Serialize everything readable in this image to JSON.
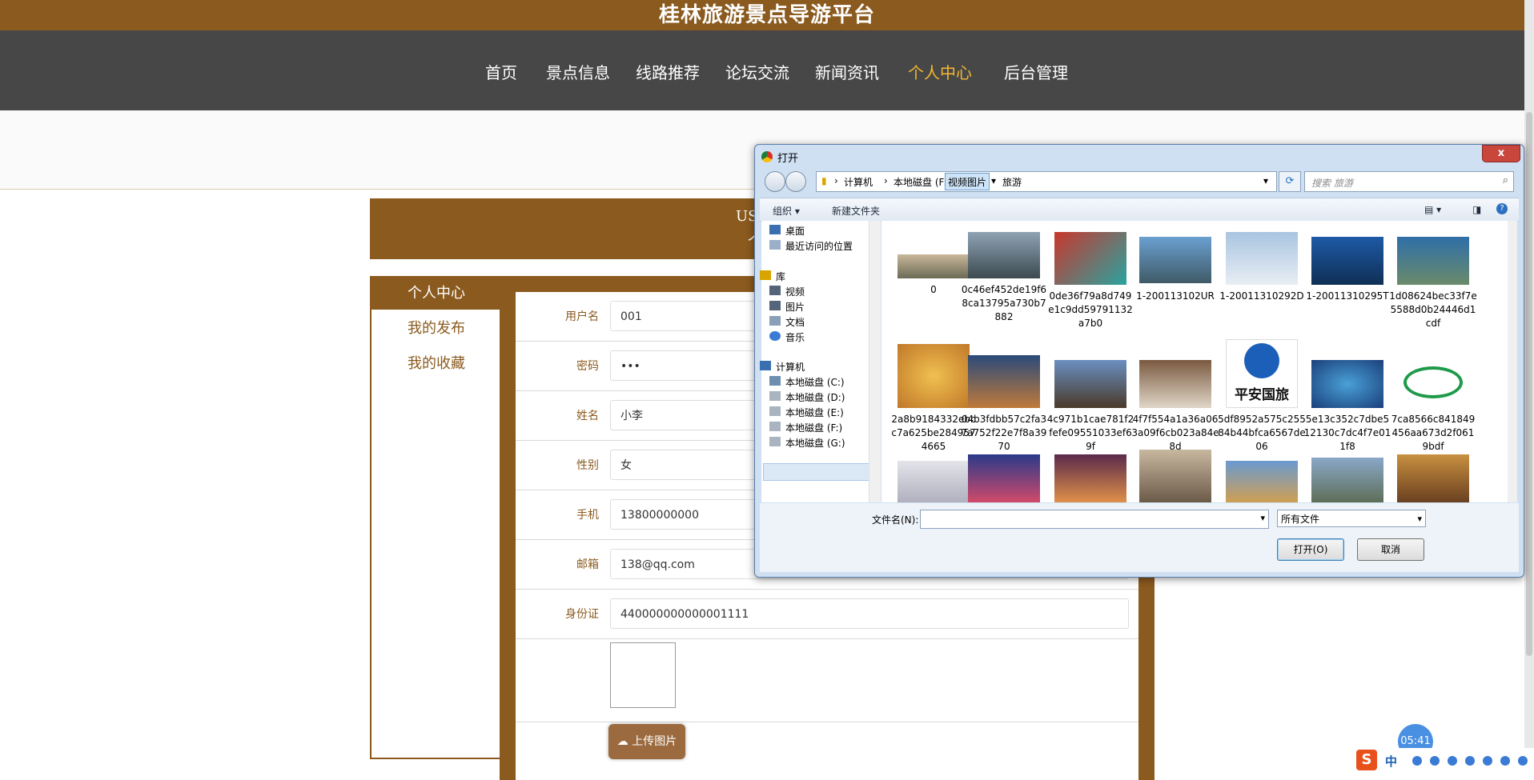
{
  "site": {
    "title": "桂林旅游景点导游平台",
    "nav": [
      "首页",
      "景点信息",
      "线路推荐",
      "论坛交流",
      "新闻资讯",
      "个人中心",
      "后台管理"
    ],
    "active_nav": "个人中心"
  },
  "user_banner": {
    "line1": "USER /",
    "line2": "个人"
  },
  "sidebar": {
    "head": "个人中心",
    "items": [
      "我的发布",
      "我的收藏"
    ]
  },
  "form": {
    "fields": [
      {
        "label": "用户名",
        "value": "001"
      },
      {
        "label": "密码",
        "value": "•••"
      },
      {
        "label": "姓名",
        "value": "小李"
      },
      {
        "label": "性别",
        "value": "女"
      },
      {
        "label": "手机",
        "value": "13800000000"
      },
      {
        "label": "邮箱",
        "value": "138@qq.com"
      },
      {
        "label": "身份证",
        "value": "440000000000001111"
      }
    ],
    "upload_label": "上传图片"
  },
  "dialog": {
    "title": "打开",
    "close": "x",
    "breadcrumb": [
      "计算机",
      "本地磁盘 (F:)",
      "视频图片",
      "旅游"
    ],
    "search_placeholder": "搜索 旅游",
    "toolbar": {
      "organize": "组织 ▾",
      "new_folder": "新建文件夹"
    },
    "tree": {
      "favorites": [
        "桌面",
        "最近访问的位置"
      ],
      "library_head": "库",
      "library": [
        "视频",
        "图片",
        "文档",
        "音乐"
      ],
      "computer_head": "计算机",
      "drives": [
        "本地磁盘 (C:)",
        "本地磁盘 (D:)",
        "本地磁盘 (E:)",
        "本地磁盘 (F:)",
        "本地磁盘 (G:)"
      ]
    },
    "files": [
      "0",
      "0c46ef452de19f68ca13795a730b7882",
      "0de36f79a8d749e1c9dd59791132a7b0",
      "1-200113102UR",
      "1-20011310292D",
      "1-20011310295T",
      "1d08624bec33f7e5588d0b24446d1cdf",
      "2a8b9184332ebcc7a625be2849574665",
      "04b3fdbb57c2fa37a752f22e7f8a3970",
      "4c971b1cae781f2fefe09551033ef69f",
      "4f7f554a1a36a063a09f6cb023a84e8d",
      "5df8952a575c25584b44bfca6567de06",
      "5e13c352c7dbe512130c7dc4f7e011f8",
      "7ca8566c841849456aa673d2f0619bdf"
    ],
    "logo_text": "平安国旅",
    "filename_label": "文件名(N):",
    "filetype": "所有文件",
    "open_button": "打开(O)",
    "cancel_button": "取消"
  },
  "taskbar": {
    "clock": "05:41",
    "ime": "中"
  }
}
